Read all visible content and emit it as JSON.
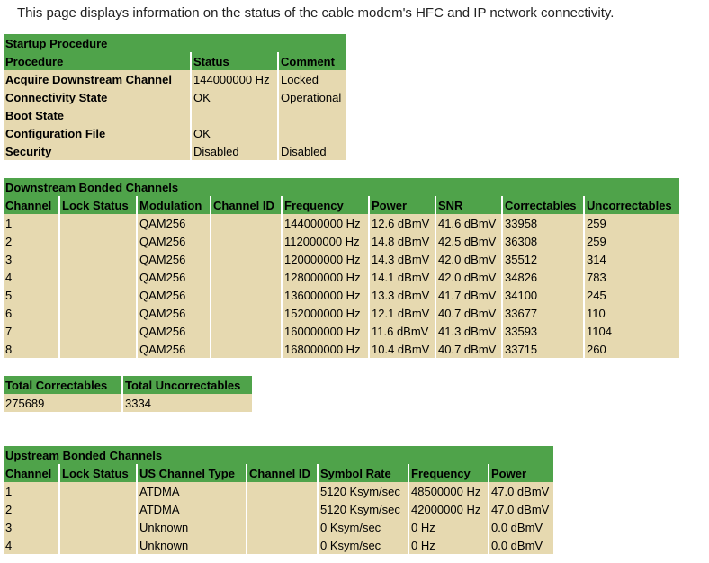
{
  "intro": "This page displays information on the status of the cable modem's HFC and IP network connectivity.",
  "startup": {
    "title": "Startup Procedure",
    "headers": [
      "Procedure",
      "Status",
      "Comment"
    ],
    "rows": [
      [
        "Acquire Downstream Channel",
        "144000000 Hz",
        "Locked"
      ],
      [
        "Connectivity State",
        "OK",
        "Operational"
      ],
      [
        "Boot State",
        "",
        ""
      ],
      [
        "Configuration File",
        "OK",
        ""
      ],
      [
        "Security",
        "Disabled",
        "Disabled"
      ]
    ]
  },
  "downstream": {
    "title": "Downstream Bonded Channels",
    "headers": [
      "Channel",
      "Lock Status",
      "Modulation",
      "Channel ID",
      "Frequency",
      "Power",
      "SNR",
      "Correctables",
      "Uncorrectables"
    ],
    "rows": [
      [
        "1",
        "",
        "QAM256",
        "",
        "144000000 Hz",
        "12.6 dBmV",
        "41.6 dBmV",
        "33958",
        "259"
      ],
      [
        "2",
        "",
        "QAM256",
        "",
        "112000000 Hz",
        "14.8 dBmV",
        "42.5 dBmV",
        "36308",
        "259"
      ],
      [
        "3",
        "",
        "QAM256",
        "",
        "120000000 Hz",
        "14.3 dBmV",
        "42.0 dBmV",
        "35512",
        "314"
      ],
      [
        "4",
        "",
        "QAM256",
        "",
        "128000000 Hz",
        "14.1 dBmV",
        "42.0 dBmV",
        "34826",
        "783"
      ],
      [
        "5",
        "",
        "QAM256",
        "",
        "136000000 Hz",
        "13.3 dBmV",
        "41.7 dBmV",
        "34100",
        "245"
      ],
      [
        "6",
        "",
        "QAM256",
        "",
        "152000000 Hz",
        "12.1 dBmV",
        "40.7 dBmV",
        "33677",
        "110"
      ],
      [
        "7",
        "",
        "QAM256",
        "",
        "160000000 Hz",
        "11.6 dBmV",
        "41.3 dBmV",
        "33593",
        "1104"
      ],
      [
        "8",
        "",
        "QAM256",
        "",
        "168000000 Hz",
        "10.4 dBmV",
        "40.7 dBmV",
        "33715",
        "260"
      ]
    ]
  },
  "totals": {
    "headers": [
      "Total Correctables",
      "Total Uncorrectables"
    ],
    "values": [
      "275689",
      "3334"
    ]
  },
  "upstream": {
    "title": "Upstream Bonded Channels",
    "headers": [
      "Channel",
      "Lock Status",
      "US Channel Type",
      "Channel ID",
      "Symbol Rate",
      "Frequency",
      "Power"
    ],
    "rows": [
      [
        "1",
        "",
        "ATDMA",
        "",
        "5120 Ksym/sec",
        "48500000 Hz",
        "47.0 dBmV"
      ],
      [
        "2",
        "",
        "ATDMA",
        "",
        "5120 Ksym/sec",
        "42000000 Hz",
        "47.0 dBmV"
      ],
      [
        "3",
        "",
        "Unknown",
        "",
        "0 Ksym/sec",
        "0 Hz",
        "0.0 dBmV"
      ],
      [
        "4",
        "",
        "Unknown",
        "",
        "0 Ksym/sec",
        "0 Hz",
        "0.0 dBmV"
      ]
    ]
  },
  "colors": {
    "header_green": "#4fa34a",
    "row_tan": "#e6d9b0"
  }
}
